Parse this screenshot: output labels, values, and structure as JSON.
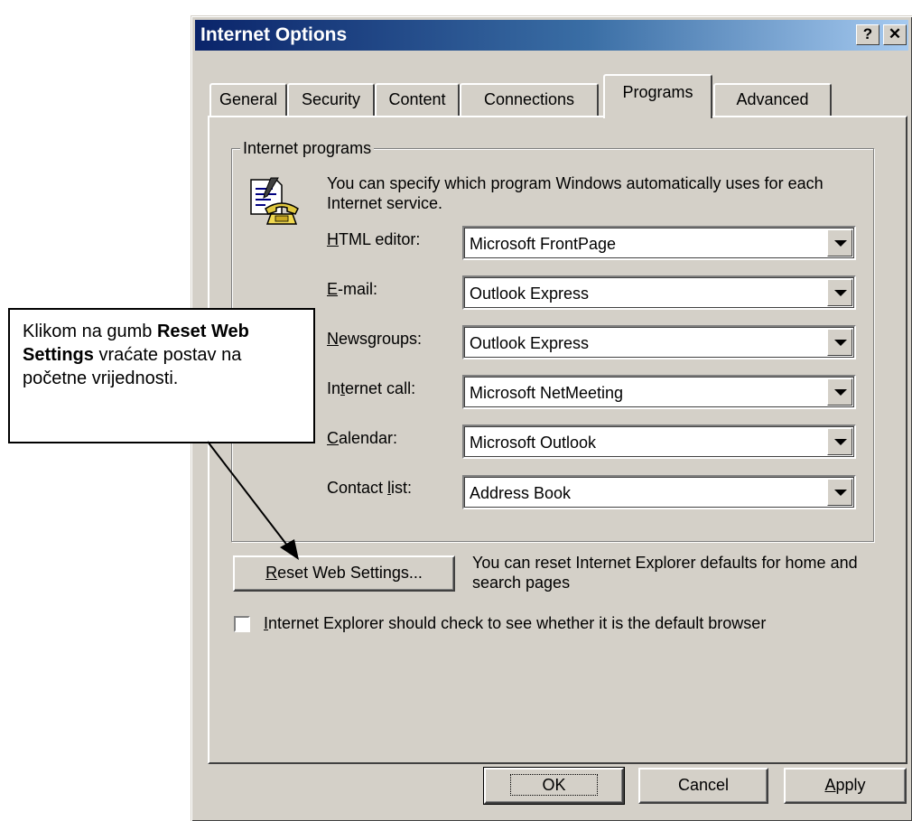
{
  "window": {
    "title": "Internet Options",
    "help_glyph": "?",
    "close_glyph": "✕"
  },
  "tabs": [
    {
      "label": "General",
      "active": false
    },
    {
      "label": "Security",
      "active": false
    },
    {
      "label": "Content",
      "active": false
    },
    {
      "label": "Connections",
      "active": false
    },
    {
      "label": "Programs",
      "active": true
    },
    {
      "label": "Advanced",
      "active": false
    }
  ],
  "programs": {
    "group_label": "Internet programs",
    "intro": "You can specify which program Windows automatically uses for each Internet service.",
    "icon": "programs-phone-notepad-icon",
    "rows": [
      {
        "pre": "",
        "key": "H",
        "post": "TML editor:",
        "value": "Microsoft FrontPage"
      },
      {
        "pre": "",
        "key": "E",
        "post": "-mail:",
        "value": "Outlook Express"
      },
      {
        "pre": "",
        "key": "N",
        "post": "ewsgroups:",
        "value": "Outlook Express"
      },
      {
        "pre": "In",
        "key": "t",
        "post": "ernet call:",
        "value": "Microsoft NetMeeting"
      },
      {
        "pre": "",
        "key": "C",
        "post": "alendar:",
        "value": "Microsoft Outlook"
      },
      {
        "pre": "Contact ",
        "key": "l",
        "post": "ist:",
        "value": "Address Book"
      }
    ]
  },
  "reset": {
    "pre": "",
    "key": "R",
    "post": "eset Web Settings...",
    "description": "You can reset Internet Explorer defaults for home and search pages"
  },
  "default_check": {
    "checked": false,
    "pre": "",
    "key": "I",
    "post": "nternet Explorer should check to see whether it is the default browser"
  },
  "footer": {
    "ok": "OK",
    "cancel": "Cancel",
    "apply_key": "A",
    "apply_rest": "pply"
  },
  "callout": {
    "part1": "Klikom na gumb ",
    "bold": "Reset Web Settings",
    "part2": " vraćate postav na početne vrijednosti."
  },
  "colors": {
    "face": "#d4d0c8",
    "title_start": "#0a246a",
    "title_end": "#a6caf0"
  }
}
